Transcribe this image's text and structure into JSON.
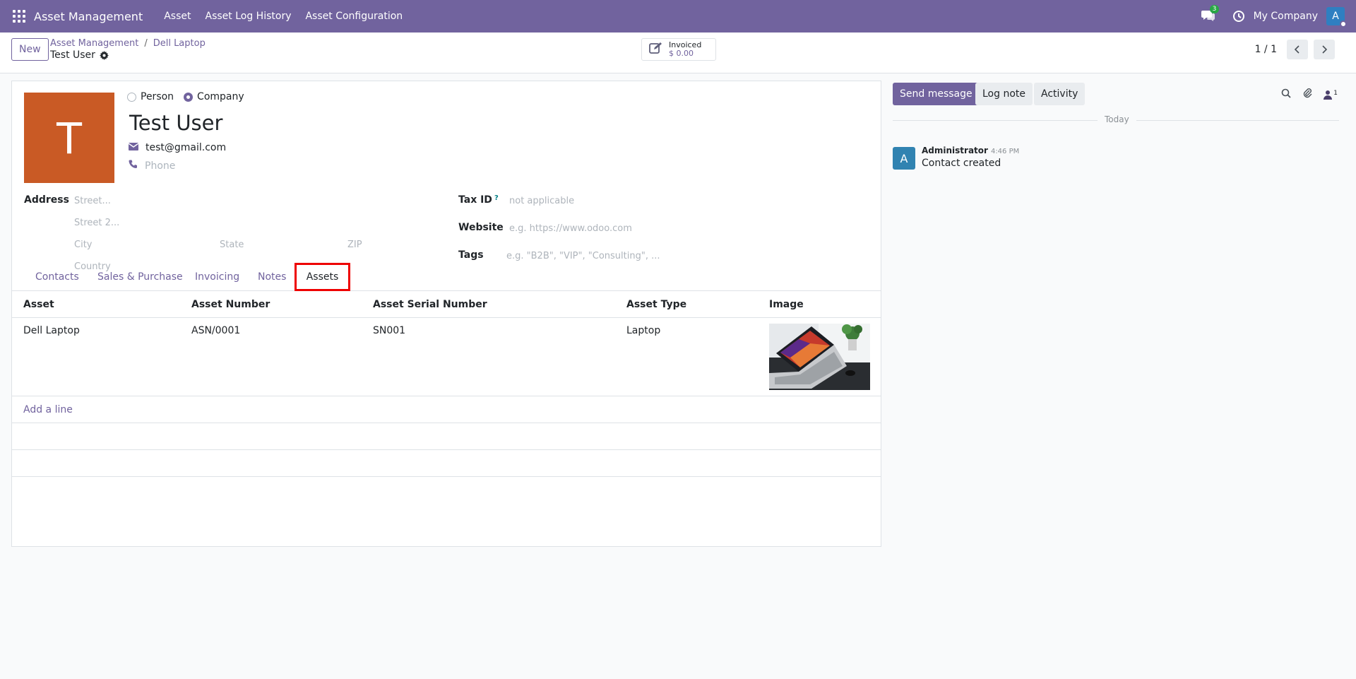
{
  "navbar": {
    "brand": "Asset Management",
    "menu": [
      "Asset",
      "Asset Log History",
      "Asset Configuration"
    ],
    "chat_count": "3",
    "company": "My Company",
    "avatar_letter": "A",
    "bg": "#71639e"
  },
  "control": {
    "new_label": "New",
    "breadcrumb": [
      "Asset Management",
      "Dell Laptop"
    ],
    "record_name": "Test User",
    "stat_label": "Invoiced",
    "stat_value": "$ 0.00",
    "pager": "1 / 1"
  },
  "form": {
    "avatar_letter": "T",
    "avatar_color": "#c95a25",
    "type_options": [
      "Person",
      "Company"
    ],
    "type_selected": "Company",
    "name": "Test User",
    "email": "test@gmail.com",
    "phone_placeholder": "Phone",
    "address_label": "Address",
    "street_ph": "Street...",
    "street2_ph": "Street 2...",
    "city_ph": "City",
    "state_ph": "State",
    "zip_ph": "ZIP",
    "country_ph": "Country",
    "taxid_label": "Tax ID",
    "taxid_help": "?",
    "taxid_ph": "not applicable",
    "website_label": "Website",
    "website_ph": "e.g. https://www.odoo.com",
    "tags_label": "Tags",
    "tags_ph": "e.g. \"B2B\", \"VIP\", \"Consulting\", ..."
  },
  "tabs": [
    "Contacts",
    "Sales & Purchase",
    "Invoicing",
    "Notes",
    "Assets"
  ],
  "active_tab": "Assets",
  "table": {
    "headers": [
      "Asset",
      "Asset Number",
      "Asset Serial Number",
      "Asset Type",
      "Image"
    ],
    "rows": [
      [
        "Dell Laptop",
        "ASN/0001",
        "SN001",
        "Laptop"
      ]
    ],
    "add_line": "Add a line"
  },
  "chatter": {
    "send_message": "Send message",
    "log_note": "Log note",
    "activity": "Activity",
    "followers": "1",
    "today": "Today",
    "message": {
      "author": "Administrator",
      "time": "4:46 PM",
      "body": "Contact created",
      "avatar": "A"
    }
  }
}
